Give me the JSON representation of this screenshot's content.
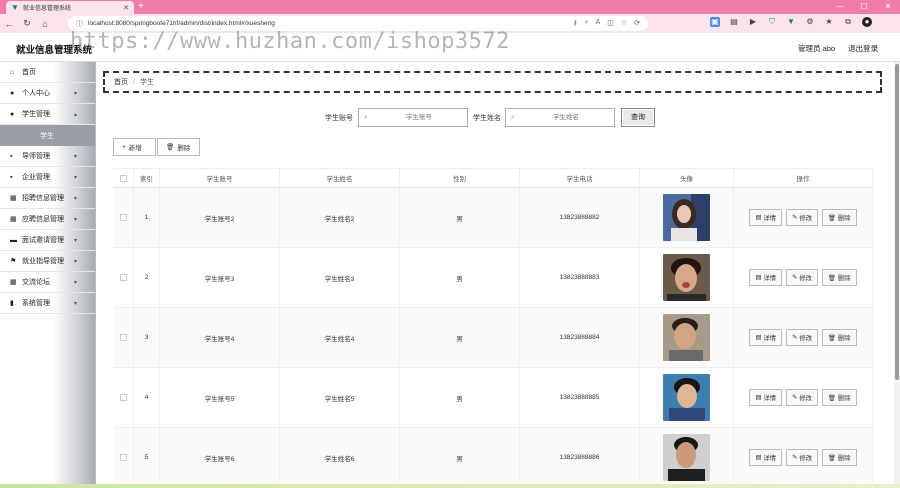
{
  "browser": {
    "tab_title": "就业信息管理系统",
    "url": "localhost:8080/springboote71hf/admin/dist/index.html#/xuesheng"
  },
  "header": {
    "title": "就业信息管理系统",
    "user": "管理员 abo",
    "logout": "退出登录",
    "watermark": "https://www.huzhan.com/ishop3572"
  },
  "sidebar": {
    "items": [
      {
        "label": "首页",
        "icon": "home-icon",
        "arrow": false
      },
      {
        "label": "个人中心",
        "icon": "user-icon",
        "arrow": true
      },
      {
        "label": "学生管理",
        "icon": "user-icon",
        "arrow": true
      },
      {
        "label": "导师管理",
        "icon": "briefcase-icon",
        "arrow": true
      },
      {
        "label": "企业管理",
        "icon": "briefcase-icon",
        "arrow": true
      },
      {
        "label": "招聘信息管理",
        "icon": "grid-icon",
        "arrow": true
      },
      {
        "label": "应聘信息管理",
        "icon": "grid-icon",
        "arrow": true
      },
      {
        "label": "面试邀请管理",
        "icon": "card-icon",
        "arrow": true
      },
      {
        "label": "就业指导管理",
        "icon": "flag-icon",
        "arrow": true
      },
      {
        "label": "交流论坛",
        "icon": "grid-icon",
        "arrow": true
      },
      {
        "label": "系统管理",
        "icon": "bar-chart-icon",
        "arrow": true
      }
    ],
    "submenu_active": "学生"
  },
  "breadcrumb": {
    "home": "首页",
    "separator": "/",
    "current": "学生"
  },
  "search": {
    "account_label": "学生账号",
    "account_placeholder": "学生账号",
    "name_label": "学生姓名",
    "name_placeholder": "学生姓名",
    "button": "查询"
  },
  "actions": {
    "add": "新增",
    "delete": "删除"
  },
  "table": {
    "headers": [
      "索引",
      "学生账号",
      "学生姓名",
      "性别",
      "学生电话",
      "头像",
      "操作"
    ],
    "op_labels": {
      "detail": "详情",
      "edit": "修改",
      "delete": "删除"
    },
    "rows": [
      {
        "index": "1",
        "account": "学生账号2",
        "name": "学生姓名2",
        "gender": "男",
        "phone": "13823888882"
      },
      {
        "index": "2",
        "account": "学生账号3",
        "name": "学生姓名3",
        "gender": "男",
        "phone": "13823888883"
      },
      {
        "index": "3",
        "account": "学生账号4",
        "name": "学生姓名4",
        "gender": "男",
        "phone": "13823888884"
      },
      {
        "index": "4",
        "account": "学生账号5",
        "name": "学生姓名5",
        "gender": "男",
        "phone": "13823888885"
      },
      {
        "index": "5",
        "account": "学生账号6",
        "name": "学生姓名6",
        "gender": "男",
        "phone": "13823888886"
      }
    ]
  },
  "colors": {
    "chrome_accent": "#f07ca8",
    "sidebar_active": "#9a9ea6"
  }
}
